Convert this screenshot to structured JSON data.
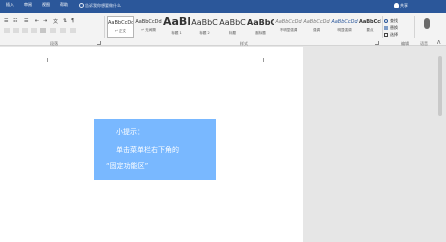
{
  "tabs": [
    {
      "label": "插入"
    },
    {
      "label": "审阅"
    },
    {
      "label": "视图"
    },
    {
      "label": "帮助"
    }
  ],
  "tell_me": "告诉我你想要做什么",
  "share": "共享",
  "groups": {
    "paragraph": "段落",
    "styles": "样式",
    "editing": "编辑",
    "voice": "语音"
  },
  "styles": [
    {
      "sample": "AaBbCcDd",
      "name": "↵ 正文"
    },
    {
      "sample": "AaBbCcDd",
      "name": "↵ 无间隔"
    },
    {
      "sample": "AaBl",
      "name": "标题 1"
    },
    {
      "sample": "AaBbC",
      "name": "标题 2"
    },
    {
      "sample": "AaBbC",
      "name": "标题"
    },
    {
      "sample": "AaBbC",
      "name": "副标题"
    },
    {
      "sample": "AaBbCcDd",
      "name": "不明显强调"
    },
    {
      "sample": "AaBbCcDd",
      "name": "强调"
    },
    {
      "sample": "AaBbCcDd",
      "name": "明显强调"
    },
    {
      "sample": "AaBbCcDd",
      "name": "要点"
    }
  ],
  "editing": {
    "find": "查找",
    "replace": "替换",
    "select": "选择"
  },
  "note": {
    "line1": "小提示：",
    "line2": "单击菜单栏右下角的",
    "line3": "“固定功能区”"
  },
  "colors": {
    "titlebar": "#2b579a",
    "note_bg": "#79b8ff"
  }
}
